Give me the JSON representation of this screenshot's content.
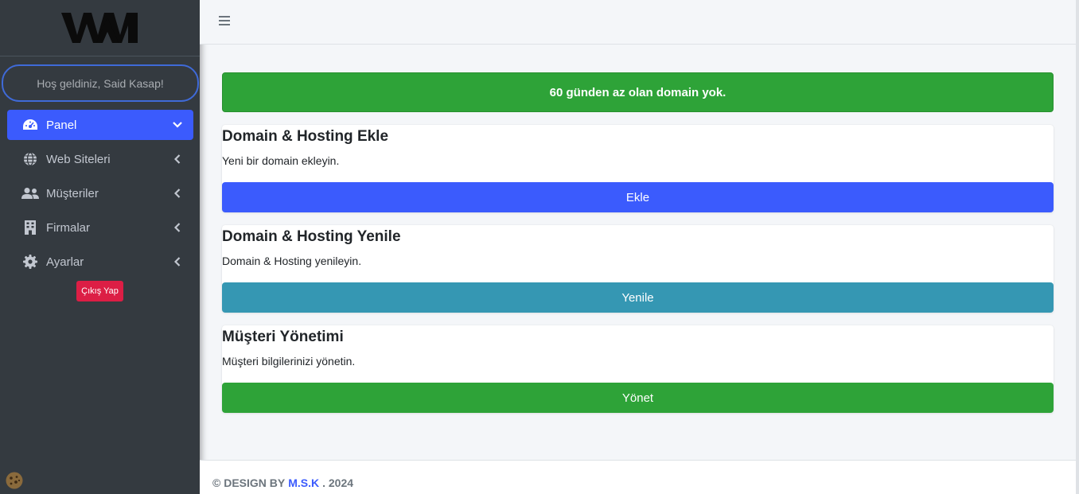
{
  "sidebar": {
    "logo_text": "WM",
    "welcome": "Hoş geldiniz, Said Kasap!",
    "items": [
      {
        "label": "Panel",
        "icon": "dashboard-icon"
      },
      {
        "label": "Web Siteleri",
        "icon": "globe-icon"
      },
      {
        "label": "Müşteriler",
        "icon": "users-icon"
      },
      {
        "label": "Firmalar",
        "icon": "building-icon"
      },
      {
        "label": "Ayarlar",
        "icon": "gear-icon"
      }
    ],
    "logout": "Çıkış Yap"
  },
  "alert": "60 günden az olan domain yok.",
  "cards": [
    {
      "title": "Domain & Hosting Ekle",
      "text": "Yeni bir domain ekleyin.",
      "button": "Ekle"
    },
    {
      "title": "Domain & Hosting Yenile",
      "text": "Domain & Hosting yenileyin.",
      "button": "Yenile"
    },
    {
      "title": "Müşteri Yönetimi",
      "text": "Müşteri bilgilerinizi yönetin.",
      "button": "Yönet"
    }
  ],
  "footer": {
    "prefix": "© DESIGN BY",
    "brand": "M.S.K",
    "suffix": ". 2024"
  },
  "colors": {
    "sidebar_bg": "#343a40",
    "primary": "#3b5bfd",
    "success": "#2ea338",
    "info": "#3597b3",
    "danger": "#dc1e45"
  }
}
